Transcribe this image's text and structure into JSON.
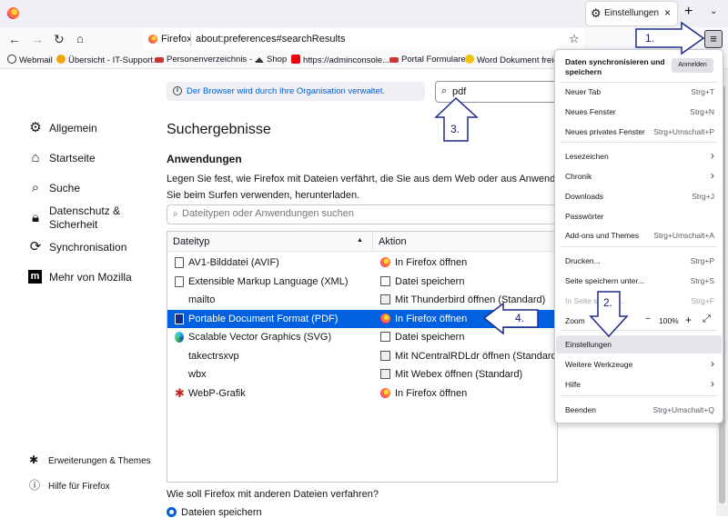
{
  "tab": {
    "title": "Einstellungen"
  },
  "urlbar": {
    "identity": "Firefox",
    "url": "about:preferences#searchResults"
  },
  "bookmarks": [
    {
      "label": "Webmail",
      "icon": "globe-icon"
    },
    {
      "label": "Übersicht - IT-Support...",
      "icon": "bookmark-icon"
    },
    {
      "label": "Personenverzeichnis - ...",
      "icon": "bookmark-icon"
    },
    {
      "label": "Shop",
      "icon": "shop-icon"
    },
    {
      "label": "https://adminconsole....",
      "icon": "adobe-icon"
    },
    {
      "label": "Portal Formulare",
      "icon": "bookmark-icon"
    },
    {
      "label": "Word Dokument freig...",
      "icon": "bookmark-icon"
    }
  ],
  "policy_notice": "Der Browser wird durch Ihre Organisation verwaltet.",
  "search": {
    "value": "pdf"
  },
  "sidebar": {
    "items": [
      {
        "label": "Allgemein",
        "icon": "gear-icon"
      },
      {
        "label": "Startseite",
        "icon": "home-icon"
      },
      {
        "label": "Suche",
        "icon": "search-icon"
      },
      {
        "label_line1": "Datenschutz &",
        "label_line2": "Sicherheit",
        "icon": "lock-icon"
      },
      {
        "label": "Synchronisation",
        "icon": "sync-icon"
      },
      {
        "label": "Mehr von Mozilla",
        "icon": "mozilla-icon"
      }
    ],
    "footer": [
      {
        "label": "Erweiterungen & Themes",
        "icon": "puzzle-icon"
      },
      {
        "label": "Hilfe für Firefox",
        "icon": "help-icon"
      }
    ]
  },
  "content": {
    "heading": "Suchergebnisse",
    "apps_heading": "Anwendungen",
    "description": "Legen Sie fest, wie Firefox mit Dateien verfährt, die Sie aus dem Web oder aus Anwendungen, d",
    "description2": "Sie beim Surfen verwenden, herunterladen.",
    "apps_search_placeholder": "Dateitypen oder Anwendungen suchen",
    "table": {
      "col_type": "Dateityp",
      "col_action": "Aktion",
      "rows": [
        {
          "type": "AV1-Bilddatei (AVIF)",
          "type_icon": "doc",
          "action": "In Firefox öffnen",
          "action_icon": "ff"
        },
        {
          "type": "Extensible Markup Language (XML)",
          "type_icon": "doc",
          "action": "Datei speichern",
          "action_icon": "save"
        },
        {
          "type": "mailto",
          "type_icon": "",
          "action": "Mit Thunderbird öffnen (Standard)",
          "action_icon": "app"
        },
        {
          "type": "Portable Document Format (PDF)",
          "type_icon": "pdf",
          "action": "In Firefox öffnen",
          "action_icon": "ff",
          "selected": true
        },
        {
          "type": "Scalable Vector Graphics (SVG)",
          "type_icon": "edge",
          "action": "Datei speichern",
          "action_icon": "save"
        },
        {
          "type": "takectrsxvp",
          "type_icon": "",
          "action": "Mit NCentralRDLdr öffnen (Standard)",
          "action_icon": "app"
        },
        {
          "type": "wbx",
          "type_icon": "",
          "action": "Mit Webex öffnen (Standard)",
          "action_icon": "app"
        },
        {
          "type": "WebP-Grafik",
          "type_icon": "webp",
          "action": "In Firefox öffnen",
          "action_icon": "ff"
        }
      ]
    },
    "other_files_question": "Wie soll Firefox mit anderen Dateien verfahren?",
    "radio_save": "Dateien speichern"
  },
  "menu": {
    "sync_title": "Daten synchronisieren und speichern",
    "signin": "Anmelden",
    "items": [
      {
        "label": "Neuer Tab",
        "shortcut": "Strg+T"
      },
      {
        "label": "Neues Fenster",
        "shortcut": "Strg+N"
      },
      {
        "label": "Neues privates Fenster",
        "shortcut": "Strg+Umschalt+P"
      },
      {
        "label": "Lesezeichen",
        "submenu": true
      },
      {
        "label": "Chronik",
        "submenu": true
      },
      {
        "label": "Downloads",
        "shortcut": "Strg+J"
      },
      {
        "label": "Passwörter"
      },
      {
        "label": "Add-ons und Themes",
        "shortcut": "Strg+Umschalt+A"
      },
      {
        "label": "Drucken...",
        "shortcut": "Strg+P"
      },
      {
        "label": "Seite speichern unter...",
        "shortcut": "Strg+S"
      },
      {
        "label": "In Seite suchen...",
        "shortcut": "Strg+F",
        "disabled": true
      },
      {
        "label": "Zoom",
        "zoom_minus": "−",
        "zoom_value": "100%",
        "zoom_plus": "+"
      },
      {
        "label": "Einstellungen",
        "highlighted": true
      },
      {
        "label": "Weitere Werkzeuge",
        "submenu": true
      },
      {
        "label": "Hilfe",
        "submenu": true
      },
      {
        "label": "Beenden",
        "shortcut": "Strg+Umschalt+Q"
      }
    ]
  },
  "annotations": {
    "a1": "1.",
    "a2": "2.",
    "a3": "3.",
    "a4": "4."
  }
}
